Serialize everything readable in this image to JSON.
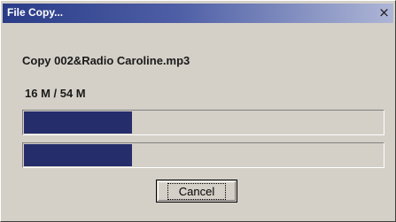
{
  "window": {
    "title": "File Copy...",
    "close_glyph": "×",
    "close_icon": "close-icon"
  },
  "copy": {
    "file_label": "Copy 002&Radio Caroline.mp3",
    "size_label": "16 M / 54 M",
    "file_progress": 0.3,
    "total_progress": 0.3
  },
  "buttons": {
    "cancel_label": "Cancel"
  },
  "colors": {
    "window_bg": "#d4d0c8",
    "title_bar_start": "#2a3c88",
    "title_bar_end": "#aeb6d6",
    "progress_fill": "#252d6b"
  }
}
